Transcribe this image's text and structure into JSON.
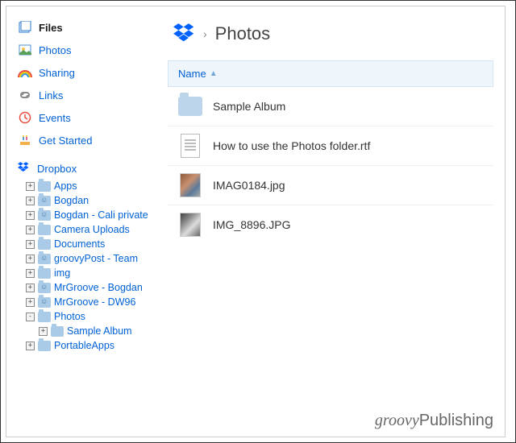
{
  "sidebar": {
    "nav": [
      {
        "label": "Files",
        "icon": "files",
        "active": true
      },
      {
        "label": "Photos",
        "icon": "photos",
        "active": false
      },
      {
        "label": "Sharing",
        "icon": "rainbow",
        "active": false
      },
      {
        "label": "Links",
        "icon": "link",
        "active": false
      },
      {
        "label": "Events",
        "icon": "clock",
        "active": false
      },
      {
        "label": "Get Started",
        "icon": "cake",
        "active": false
      }
    ],
    "tree_root": {
      "label": "Dropbox",
      "icon": "dropbox"
    },
    "tree": [
      {
        "label": "Apps",
        "shared": false,
        "exp": "+",
        "lvl": 1
      },
      {
        "label": "Bogdan",
        "shared": true,
        "exp": "+",
        "lvl": 1
      },
      {
        "label": "Bogdan - Cali private",
        "shared": true,
        "exp": "+",
        "lvl": 1
      },
      {
        "label": "Camera Uploads",
        "shared": false,
        "exp": "+",
        "lvl": 1
      },
      {
        "label": "Documents",
        "shared": false,
        "exp": "+",
        "lvl": 1
      },
      {
        "label": "groovyPost - Team",
        "shared": true,
        "exp": "+",
        "lvl": 1
      },
      {
        "label": "img",
        "shared": false,
        "exp": "+",
        "lvl": 1
      },
      {
        "label": "MrGroove - Bogdan",
        "shared": true,
        "exp": "+",
        "lvl": 1
      },
      {
        "label": "MrGroove - DW96",
        "shared": true,
        "exp": "+",
        "lvl": 1
      },
      {
        "label": "Photos",
        "shared": false,
        "exp": "-",
        "lvl": 1
      },
      {
        "label": "Sample Album",
        "shared": false,
        "exp": "+",
        "lvl": 2
      },
      {
        "label": "PortableApps",
        "shared": false,
        "exp": "+",
        "lvl": 1
      }
    ]
  },
  "main": {
    "breadcrumb": {
      "sep": "›",
      "current": "Photos"
    },
    "column": {
      "name": "Name",
      "arrow": "▲"
    },
    "files": [
      {
        "name": "Sample Album",
        "type": "folder"
      },
      {
        "name": "How to use the Photos folder.rtf",
        "type": "doc"
      },
      {
        "name": "IMAG0184.jpg",
        "type": "thumb-color"
      },
      {
        "name": "IMG_8896.JPG",
        "type": "thumb-bw"
      }
    ]
  },
  "watermark": {
    "g": "groovy",
    "p": "Publishing"
  }
}
